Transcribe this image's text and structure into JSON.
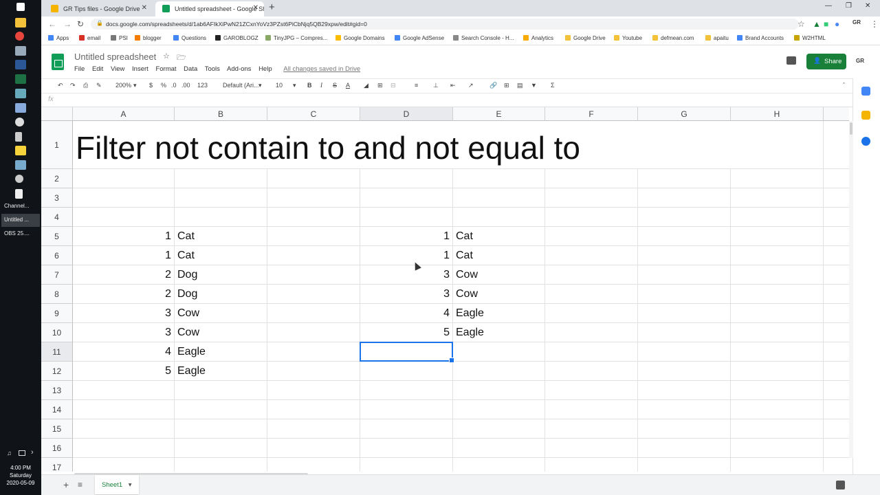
{
  "taskbar": {
    "tasks": [
      "Channel...",
      "Untitled ...",
      "OBS 25...."
    ],
    "clock": {
      "time": "4:00 PM",
      "day": "Saturday",
      "date": "2020-05-09"
    }
  },
  "browser": {
    "tabs": [
      {
        "title": "GR Tips files - Google Drive"
      },
      {
        "title": "Untitled spreadsheet - Google Sh"
      }
    ],
    "url": "docs.google.com/spreadsheets/d/1ab6AFIkXiPwN21ZCxnYoVz3PZst6PiCbNjq5QB29xpw/edit#gid=0",
    "bookmarks": [
      "Apps",
      "email",
      "PSI",
      "blogger",
      "Questions",
      "GAROBLOGZ",
      "TinyJPG – Compres...",
      "Google Domains",
      "Google AdSense",
      "Search Console - H...",
      "Analytics",
      "Google Drive",
      "Youtube",
      "defmean.com",
      "apaitu",
      "Brand Accounts",
      "W2HTML"
    ]
  },
  "sheets": {
    "title": "Untitled spreadsheet",
    "menu": [
      "File",
      "Edit",
      "View",
      "Insert",
      "Format",
      "Data",
      "Tools",
      "Add-ons",
      "Help"
    ],
    "saved_status": "All changes saved in Drive",
    "share_label": "Share",
    "account": "GR",
    "toolbar": {
      "zoom": "200%",
      "currency": "$",
      "percent": "%",
      "dec_less": ".0",
      "dec_more": ".00",
      "format": "123",
      "font": "Default (Ari...",
      "font_size": "10",
      "bold": "B",
      "italic": "I",
      "sum": "Σ"
    },
    "fx_label": "fx",
    "sheet_tab": "Sheet1"
  },
  "grid": {
    "columns": [
      "A",
      "B",
      "C",
      "D",
      "E",
      "F",
      "G",
      "H"
    ],
    "rows": [
      "1",
      "2",
      "3",
      "4",
      "5",
      "6",
      "7",
      "8",
      "9",
      "10",
      "11",
      "12",
      "13",
      "14",
      "15",
      "16",
      "17"
    ],
    "title_text": "Filter not contain to and not equal to",
    "col_a": [
      "1",
      "1",
      "2",
      "2",
      "3",
      "3",
      "4",
      "5"
    ],
    "col_b": [
      "Cat",
      "Cat",
      "Dog",
      "Dog",
      "Cow",
      "Cow",
      "Eagle",
      "Eagle"
    ],
    "col_d": [
      "1",
      "1",
      "3",
      "3",
      "4",
      "5"
    ],
    "col_e": [
      "Cat",
      "Cat",
      "Cow",
      "Cow",
      "Eagle",
      "Eagle"
    ],
    "active_cell": "D11"
  }
}
